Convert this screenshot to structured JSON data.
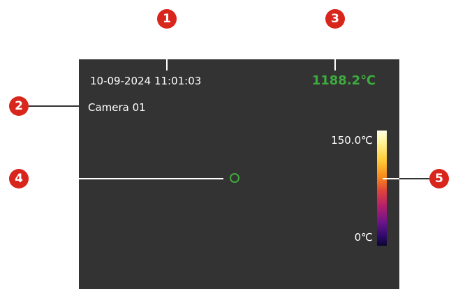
{
  "screen": {
    "datetime": "10-09-2024  11:01:03",
    "camera_name": "Camera 01",
    "max_temperature": "1188.2℃",
    "scale_max": "150.0℃",
    "scale_min": "0℃"
  },
  "callouts": [
    "1",
    "2",
    "3",
    "4",
    "5"
  ],
  "colors": {
    "callout": "#d8261c",
    "screen_background": "#333333",
    "max_temperature": "#3eab3e",
    "spot_marker": "#3eab3e",
    "overlay_text": "#ffffff"
  }
}
